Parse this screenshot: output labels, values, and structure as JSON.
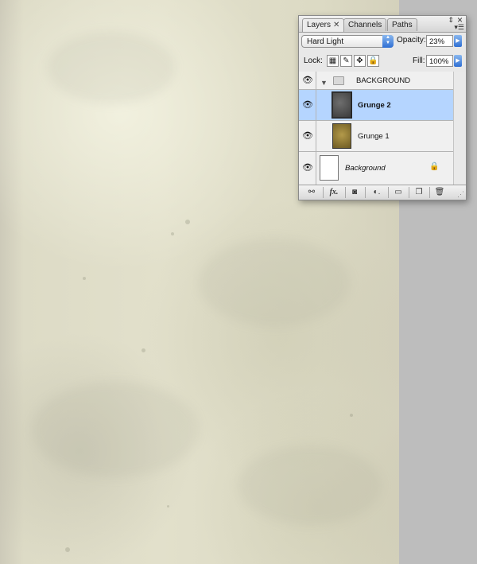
{
  "tabs": [
    {
      "label": "Layers",
      "active": true
    },
    {
      "label": "Channels",
      "active": false
    },
    {
      "label": "Paths",
      "active": false
    }
  ],
  "blend_mode": "Hard Light",
  "opacity": {
    "label": "Opacity:",
    "value": "23%"
  },
  "lock": {
    "label": "Lock:"
  },
  "fill": {
    "label": "Fill:",
    "value": "100%"
  },
  "layers": [
    {
      "name": "BACKGROUND",
      "type": "group",
      "visible": true
    },
    {
      "name": "Grunge 2",
      "type": "layer",
      "visible": true,
      "selected": true
    },
    {
      "name": "Grunge 1",
      "type": "layer",
      "visible": true
    },
    {
      "name": "Background",
      "type": "background",
      "visible": true,
      "locked": true
    }
  ],
  "colors": {
    "selection": "#b5d5ff",
    "accent_blue": "#2f6fd3",
    "workspace": "#bdbdbd",
    "panel_bg": "#e8e8e8"
  },
  "icons": {
    "close": "close-icon",
    "eye": "eye-icon",
    "folder": "folder-icon",
    "lock": "lock-icon"
  }
}
